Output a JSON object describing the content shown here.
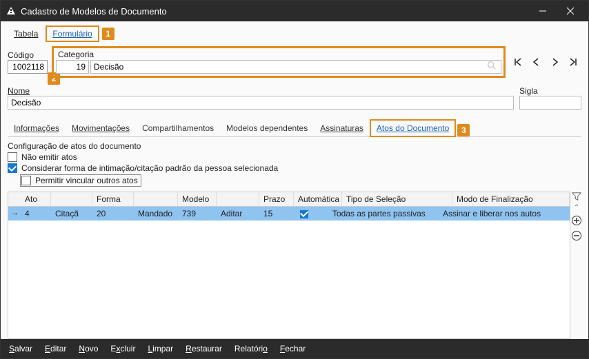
{
  "window": {
    "title": "Cadastro de Modelos de Documento"
  },
  "callouts": {
    "one": "1",
    "two": "2",
    "three": "3"
  },
  "viewTabs": {
    "tabela": "Tabela",
    "formulario": "Formulário"
  },
  "labels": {
    "codigo": "Código",
    "categoria": "Categoria",
    "nome": "Nome",
    "sigla": "Sigla"
  },
  "fields": {
    "codigo": "1002118",
    "categoria_id": "19",
    "categoria_nome": "Decisão",
    "nome": "Decisão",
    "sigla": ""
  },
  "subtabs": {
    "informacoes": "Informações",
    "movimentacoes": "Movimentações",
    "compartilhamentos": "Compartilhamentos",
    "modelos_dependentes": "Modelos dependentes",
    "assinaturas": "Assinaturas",
    "atos": "Atos do Documento"
  },
  "config": {
    "title": "Configuração de atos do documento",
    "nao_emitir": "Não emitir atos",
    "considerar": "Considerar forma de intimação/citação padrão da pessoa selecionada",
    "permitir": "Permitir vincular outros atos"
  },
  "grid": {
    "headers": {
      "ato": "Ato",
      "forma": "Forma",
      "modelo": "Modelo",
      "prazo": "Prazo",
      "automatica": "Automática",
      "tipo": "Tipo de Seleção",
      "modo": "Modo de Finalização"
    },
    "row": {
      "ato": "4",
      "ato_nome": "Citaçã",
      "forma": "20",
      "forma_nome": "Mandado",
      "modelo": "739",
      "modelo_nome": "Aditar",
      "prazo": "15",
      "automatica": "✔",
      "tipo": "Todas as partes passivas",
      "modo": "Assinar e liberar nos autos"
    }
  },
  "footer": {
    "salvar": "Salvar",
    "editar": "Editar",
    "novo": "Novo",
    "excluir": "Excluir",
    "limpar": "Limpar",
    "restaurar": "Restaurar",
    "relatorio": "Relatório",
    "fechar": "Fechar"
  }
}
